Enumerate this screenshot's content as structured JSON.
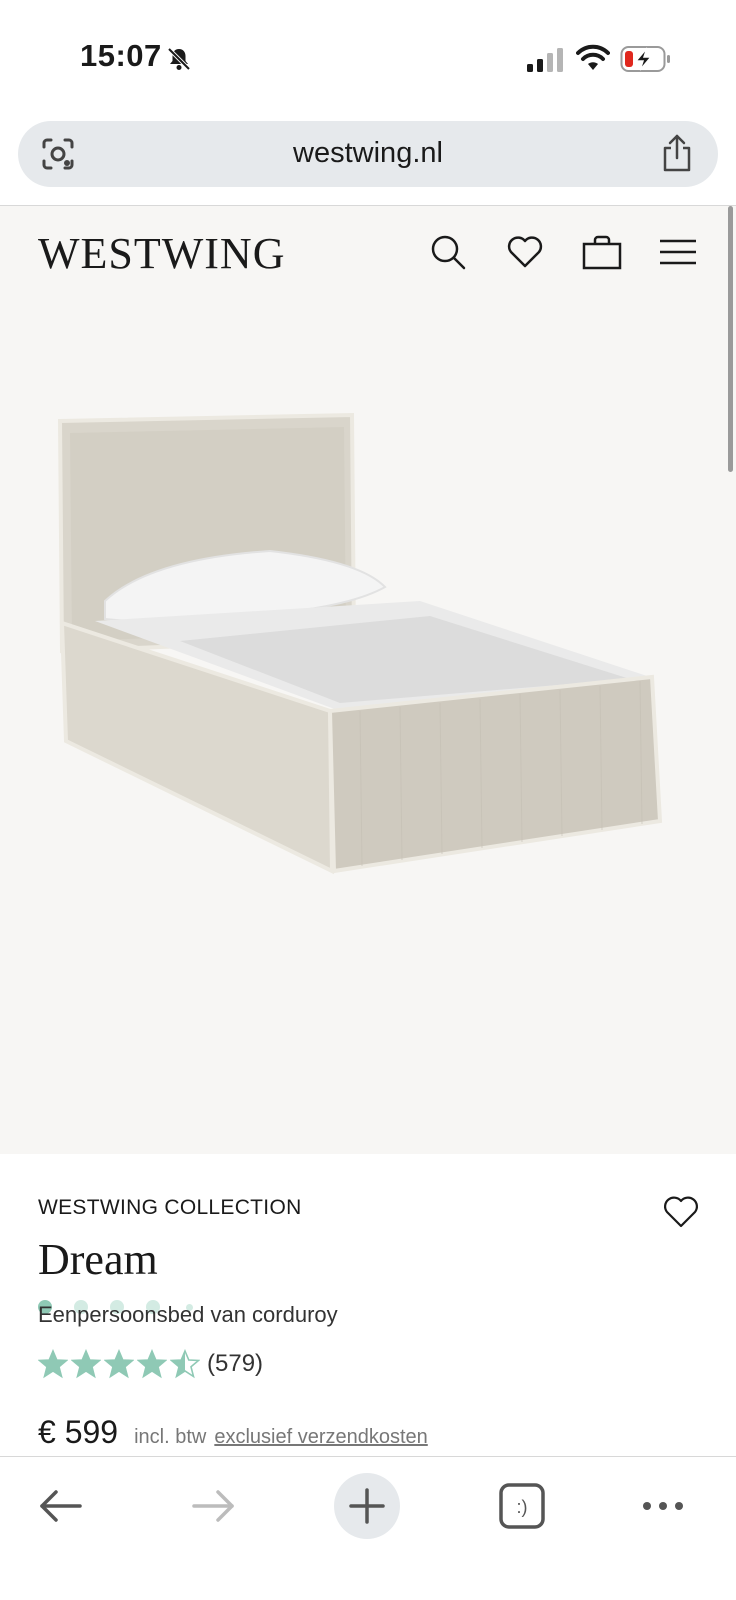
{
  "status_bar": {
    "time": "15:07",
    "icons": [
      "bell-slash-icon",
      "cellular-signal-icon",
      "wifi-icon",
      "battery-charging-icon"
    ]
  },
  "browser": {
    "url": "westwing.nl",
    "left_icon": "visual-search-icon",
    "right_icon": "share-icon"
  },
  "header": {
    "logo": "WESTWING",
    "icons": [
      "search-icon",
      "heart-icon",
      "bag-icon",
      "menu-icon"
    ]
  },
  "gallery": {
    "image": "single bed with corduroy upholstery",
    "slide_count": 5,
    "active_slide": 1,
    "accent": "#8fc9b5"
  },
  "product": {
    "brand": "WESTWING COLLECTION",
    "name": "Dream",
    "subtitle": "Eenpersoonsbed van corduroy",
    "rating_value": 4.5,
    "rating_max": 5,
    "rating_count": "(579)",
    "price": "€ 599",
    "vat_note": "incl. btw",
    "shipping_link": "exclusief verzendkosten",
    "star_color": "#8fc9b5"
  },
  "toolbar": {
    "items": [
      "back-arrow-icon",
      "forward-arrow-icon",
      "new-tab-plus-icon",
      "tabs-icon",
      "more-icon"
    ],
    "tabs_label": ":)"
  }
}
